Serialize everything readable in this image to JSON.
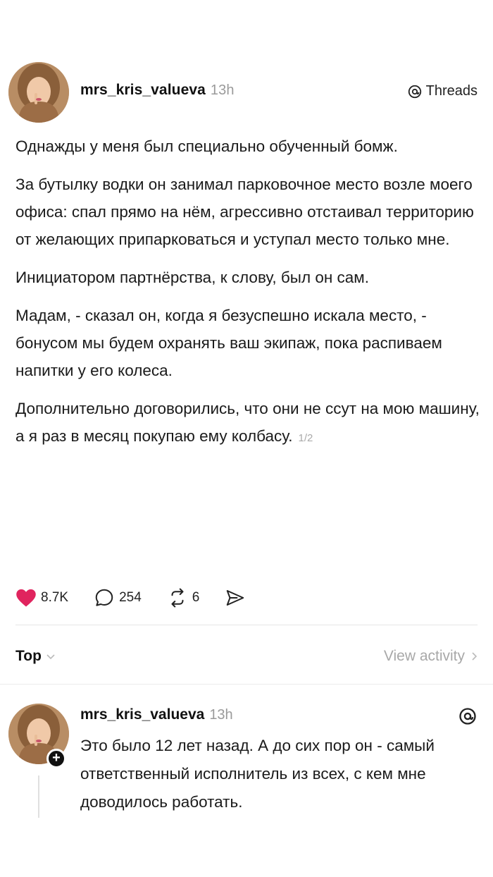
{
  "post": {
    "author": "mrs_kris_valueva",
    "time": "13h",
    "badge_label": "Threads",
    "paragraphs": [
      "Однажды у меня был специально обученный бомж.",
      "За бутылку водки он занимал парковочное место возле моего офиса: спал прямо на нём, агрессивно отстаивал территорию от желающих припарковаться и уступал место только мне.",
      "Инициатором партнёрства, к слову, был он сам.",
      "Мадам, - сказал он, когда я безуспешно искала место, - бонусом мы будем охранять ваш экипаж, пока распиваем напитки у его колеса.",
      "Дополнительно договорились, что они не ссут на мою машину, а я раз в месяц покупаю ему колбасу."
    ],
    "page_counter": "1/2",
    "actions": {
      "likes": "8.7K",
      "comments": "254",
      "reposts": "6"
    },
    "like_color": "#e0245e"
  },
  "sort": {
    "label": "Top",
    "view_activity": "View activity"
  },
  "reply": {
    "author": "mrs_kris_valueva",
    "time": "13h",
    "text": "Это было 12 лет назад. А до сих пор он - самый ответственный исполнитель из всех, с кем мне доводилось работать."
  }
}
